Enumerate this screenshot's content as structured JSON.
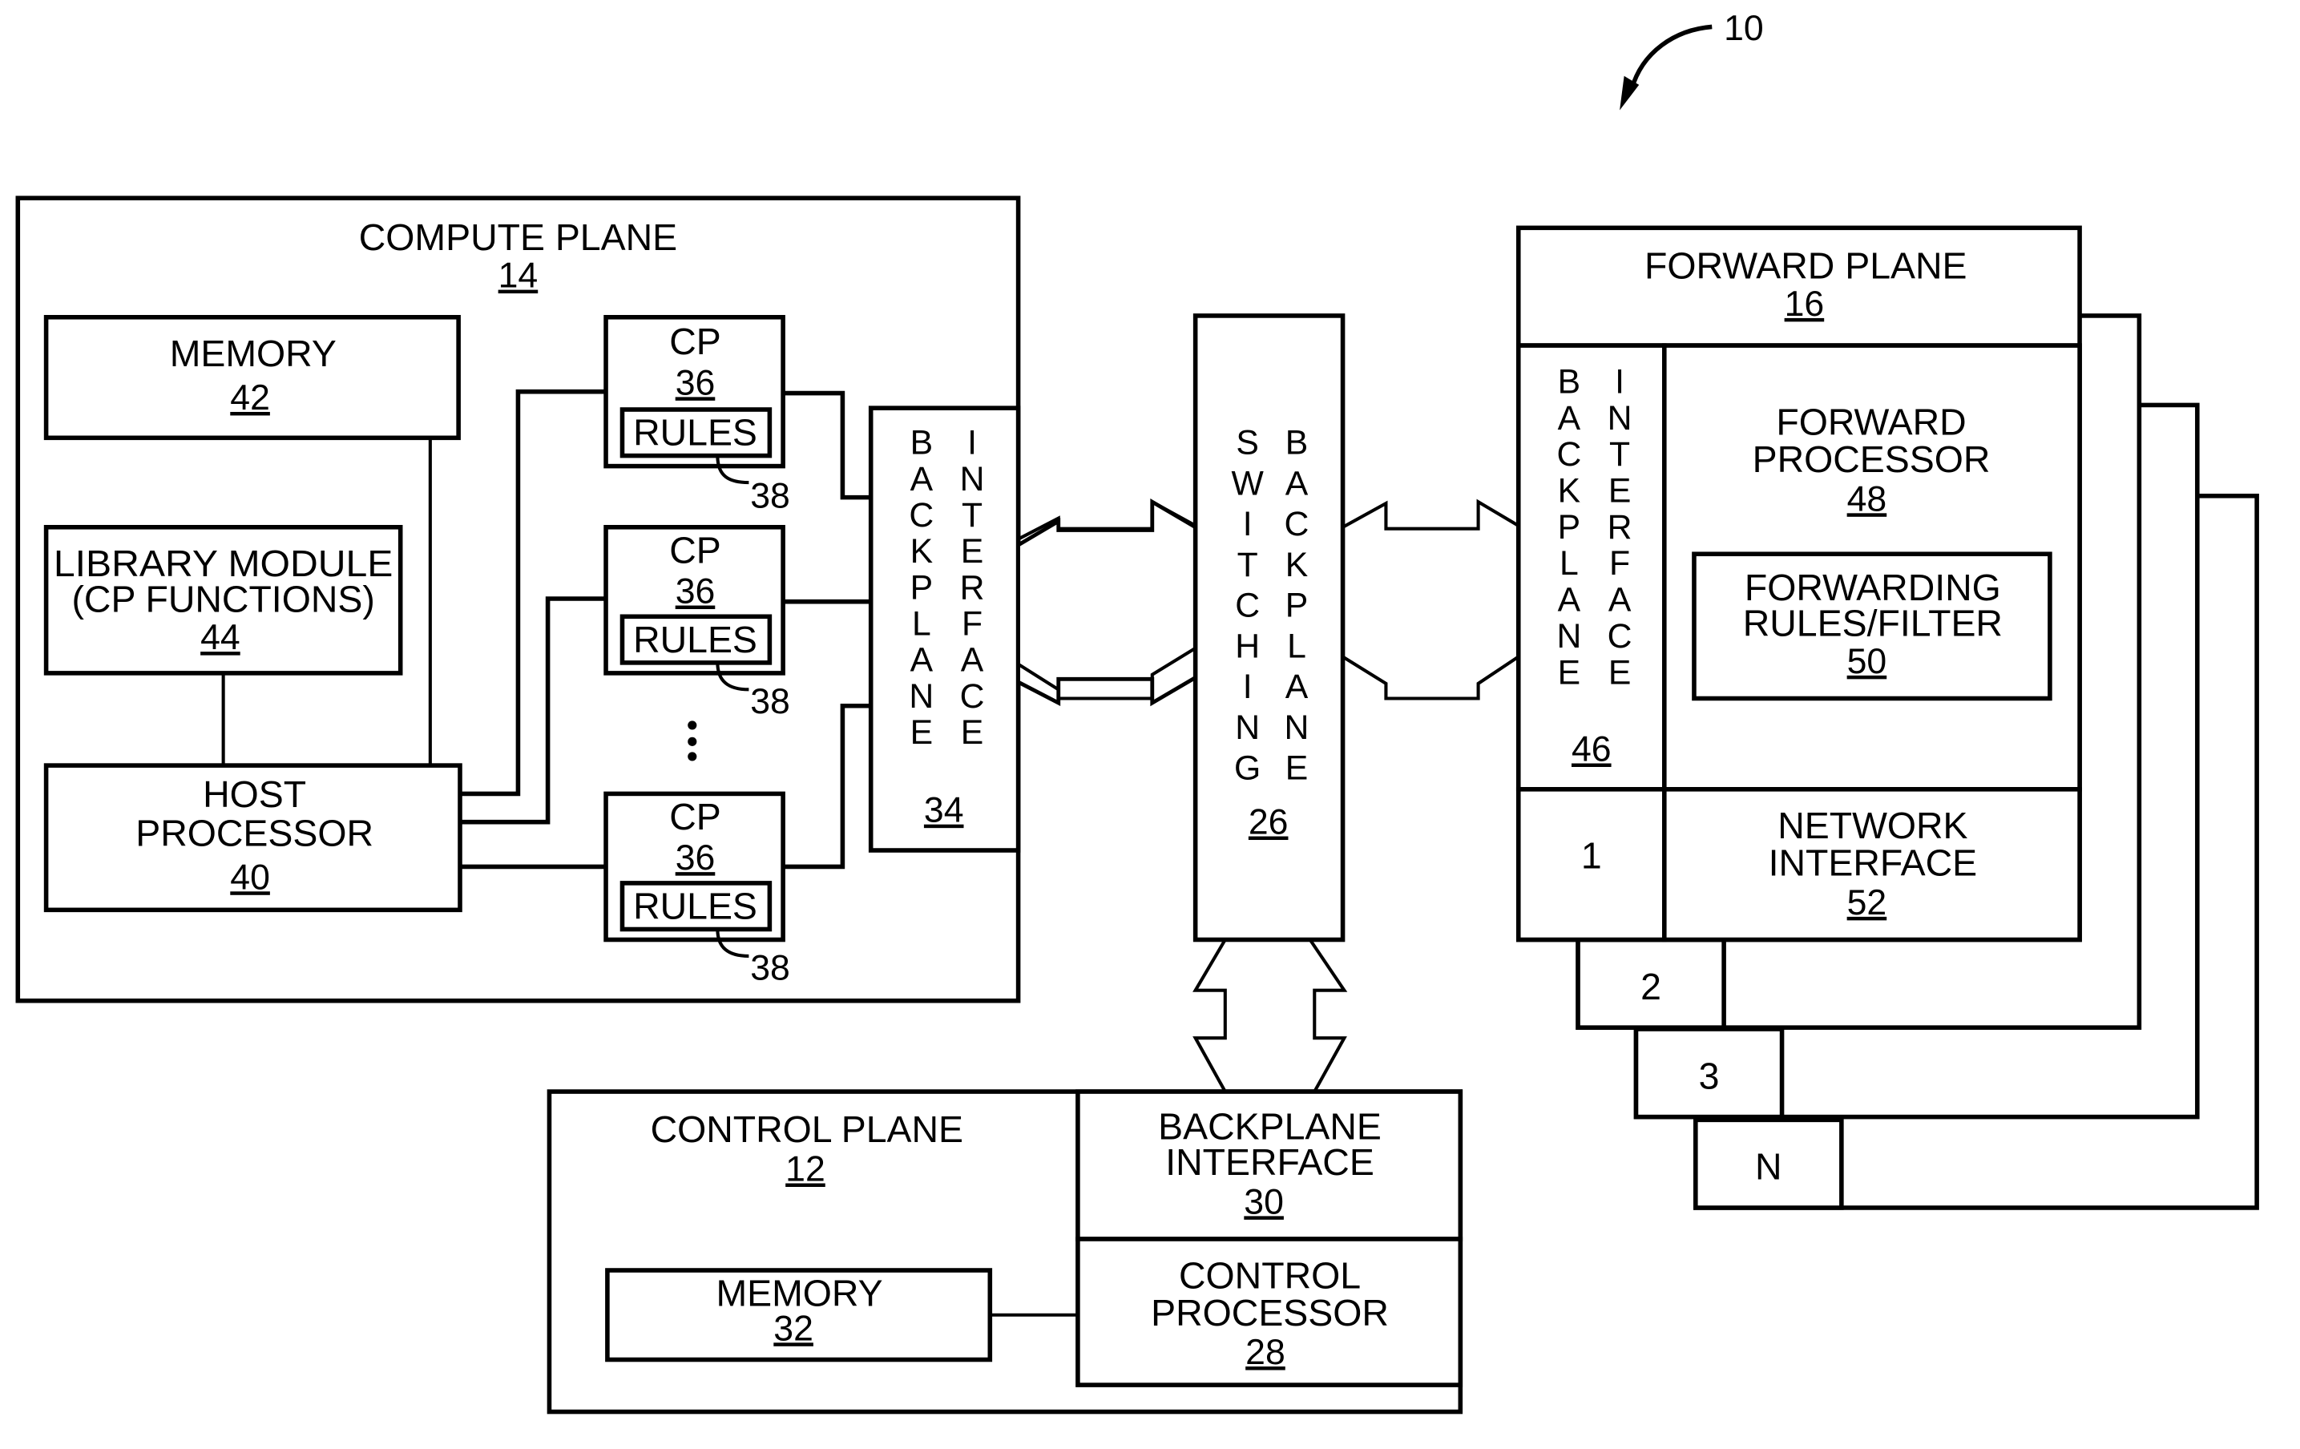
{
  "figure": {
    "reference_numeral": "10",
    "compute_plane": {
      "title": "COMPUTE PLANE",
      "number": "14",
      "memory": {
        "label": "MEMORY",
        "number": "42"
      },
      "library_module": {
        "line1": "LIBRARY MODULE",
        "line2": "(CP FUNCTIONS)",
        "number": "44"
      },
      "host_processor": {
        "line1": "HOST",
        "line2": "PROCESSOR",
        "number": "40"
      },
      "cps": [
        {
          "label": "CP",
          "number": "36",
          "rules_label": "RULES",
          "rules_ref": "38"
        },
        {
          "label": "CP",
          "number": "36",
          "rules_label": "RULES",
          "rules_ref": "38"
        },
        {
          "label": "CP",
          "number": "36",
          "rules_label": "RULES",
          "rules_ref": "38"
        }
      ],
      "ellipsis": "⋮",
      "backplane_interface": {
        "col1": [
          "B",
          "A",
          "C",
          "K",
          "P",
          "L",
          "A",
          "N",
          "E"
        ],
        "col2": [
          "I",
          "N",
          "T",
          "E",
          "R",
          "F",
          "A",
          "C",
          "E"
        ],
        "number": "34"
      }
    },
    "switching_backplane": {
      "col1": [
        "S",
        "W",
        "I",
        "T",
        "C",
        "H",
        "I",
        "N",
        "G"
      ],
      "col2": [
        "B",
        "A",
        "C",
        "K",
        "P",
        "L",
        "A",
        "N",
        "E"
      ],
      "number": "26"
    },
    "control_plane": {
      "title": "CONTROL PLANE",
      "number": "12",
      "memory": {
        "label": "MEMORY",
        "number": "32"
      },
      "backplane_interface": {
        "line1": "BACKPLANE",
        "line2": "INTERFACE",
        "number": "30"
      },
      "control_processor": {
        "line1": "CONTROL",
        "line2": "PROCESSOR",
        "number": "28"
      }
    },
    "forward_plane": {
      "title": "FORWARD PLANE",
      "number": "16",
      "backplane_interface": {
        "col1": [
          "B",
          "A",
          "C",
          "K",
          "P",
          "L",
          "A",
          "N",
          "E"
        ],
        "col2": [
          "I",
          "N",
          "T",
          "E",
          "R",
          "F",
          "A",
          "C",
          "E"
        ],
        "number": "46"
      },
      "forward_processor": {
        "line1": "FORWARD",
        "line2": "PROCESSOR",
        "number": "48"
      },
      "forwarding_rules": {
        "line1": "FORWARDING",
        "line2": "RULES/FILTER",
        "number": "50"
      },
      "network_interface": {
        "line1": "NETWORK",
        "line2": "INTERFACE",
        "number": "52"
      },
      "instances": [
        "1",
        "2",
        "3",
        "N"
      ]
    }
  }
}
